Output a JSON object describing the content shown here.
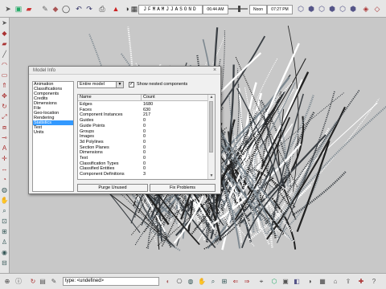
{
  "toolbar": {
    "months": "JFMAMJJASOND",
    "time_1": "06:44 AM",
    "label_noon": "Noon",
    "time_2": "07:27 PM"
  },
  "dialog": {
    "title": "Model Info",
    "close_glyph": "×",
    "categories": [
      "Animation",
      "Classifications",
      "Components",
      "Credits",
      "Dimensions",
      "File",
      "Geo-location",
      "Rendering",
      "Statistics",
      "Text",
      "Units"
    ],
    "selected_category": "Statistics",
    "scope_select": "Entire model",
    "nested_label": "Show nested components",
    "nested_checked": "✓",
    "headers": {
      "name": "Name",
      "count": "Count"
    },
    "rows": [
      {
        "name": "Edges",
        "count": "1680"
      },
      {
        "name": "Faces",
        "count": "630"
      },
      {
        "name": "Component Instances",
        "count": "217"
      },
      {
        "name": "Guides",
        "count": "0"
      },
      {
        "name": "Guide Points",
        "count": "0"
      },
      {
        "name": "Groups",
        "count": "0"
      },
      {
        "name": "Images",
        "count": "0"
      },
      {
        "name": "3d Polylines",
        "count": "0"
      },
      {
        "name": "Section Planes",
        "count": "0"
      },
      {
        "name": "Dimensions",
        "count": "0"
      },
      {
        "name": "Text",
        "count": "0"
      },
      {
        "name": "Classification Types",
        "count": "0"
      },
      {
        "name": "Classified Entities",
        "count": "0"
      },
      {
        "name": "Component Definitions",
        "count": "3"
      }
    ],
    "purge_button": "Purge Unused",
    "fix_button": "Fix Problems"
  },
  "status": {
    "type_field": "type: <undefined>"
  },
  "colors": {
    "selection": "#3399ff",
    "viewport_bg": "#c8c8c8"
  }
}
